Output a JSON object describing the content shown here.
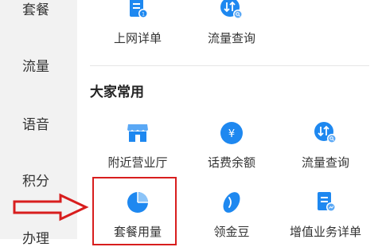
{
  "sidebar": {
    "items": [
      {
        "label": "套餐"
      },
      {
        "label": "流量"
      },
      {
        "label": "语音"
      },
      {
        "label": "积分"
      },
      {
        "label": "办理"
      }
    ]
  },
  "top_row": [
    {
      "label": "上网详单",
      "icon": "document-list-icon"
    },
    {
      "label": "流量查询",
      "icon": "data-usage-icon"
    }
  ],
  "section": {
    "title": "大家常用",
    "items": [
      {
        "label": "附近营业厅",
        "icon": "store-icon"
      },
      {
        "label": "话费余额",
        "icon": "yuan-balance-icon"
      },
      {
        "label": "流量查询",
        "icon": "data-usage-icon"
      },
      {
        "label": "套餐用量",
        "icon": "pie-chart-icon"
      },
      {
        "label": "领金豆",
        "icon": "bean-icon"
      },
      {
        "label": "增值业务详单",
        "icon": "document-chart-icon"
      }
    ]
  },
  "colors": {
    "accent": "#1e88f0",
    "annotation": "#d81e1e"
  }
}
